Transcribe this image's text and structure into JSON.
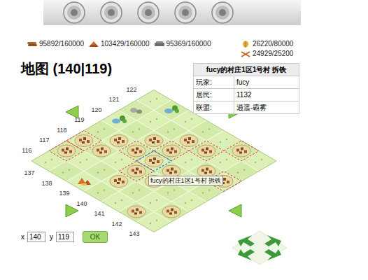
{
  "resources": [
    {
      "kind": "wood",
      "value": "95892/160000"
    },
    {
      "kind": "clay",
      "value": "103429/160000"
    },
    {
      "kind": "iron",
      "value": "95369/160000"
    },
    {
      "kind": "crop",
      "value": "26220/80000"
    },
    {
      "kind": "upkeep",
      "value": "24929/25200"
    }
  ],
  "heading": "地图 (140|119)",
  "info": {
    "title": "fucy的村庄1区1号村 拆铁",
    "rows": [
      {
        "label": "玩家:",
        "value": "fucy"
      },
      {
        "label": "居民:",
        "value": "1132"
      },
      {
        "label": "联盟:",
        "value": "逍遥-霸雾"
      }
    ]
  },
  "map": {
    "y_labels": [
      "116",
      "117",
      "118",
      "119",
      "120",
      "121",
      "122"
    ],
    "x_labels": [
      "137",
      "138",
      "139",
      "140",
      "141",
      "142",
      "143"
    ],
    "rows": [
      [
        "empty",
        "empty",
        "camp",
        "empty",
        "empty",
        "village",
        "empty"
      ],
      [
        "ally",
        "empty",
        "empty",
        "village",
        "empty",
        "empty",
        "village"
      ],
      [
        "ally",
        "village",
        "empty",
        "ally",
        "village",
        "empty",
        "empty"
      ],
      [
        "empty",
        "village",
        "ally",
        "current",
        "village",
        "empty",
        "empty"
      ],
      [
        "oasis",
        "empty",
        "village",
        "ally",
        "empty",
        "village",
        "ally"
      ],
      [
        "rocks",
        "empty",
        "empty",
        "village",
        "ally",
        "empty",
        "empty"
      ],
      [
        "empty",
        "oasis",
        "empty",
        "empty",
        "empty",
        "ally",
        "empty"
      ]
    ],
    "tooltip": "fucy的村庄1区1号村 拆铁"
  },
  "form": {
    "x_label": "x",
    "x_value": "140",
    "y_label": "y",
    "y_value": "119",
    "button": "OK"
  }
}
